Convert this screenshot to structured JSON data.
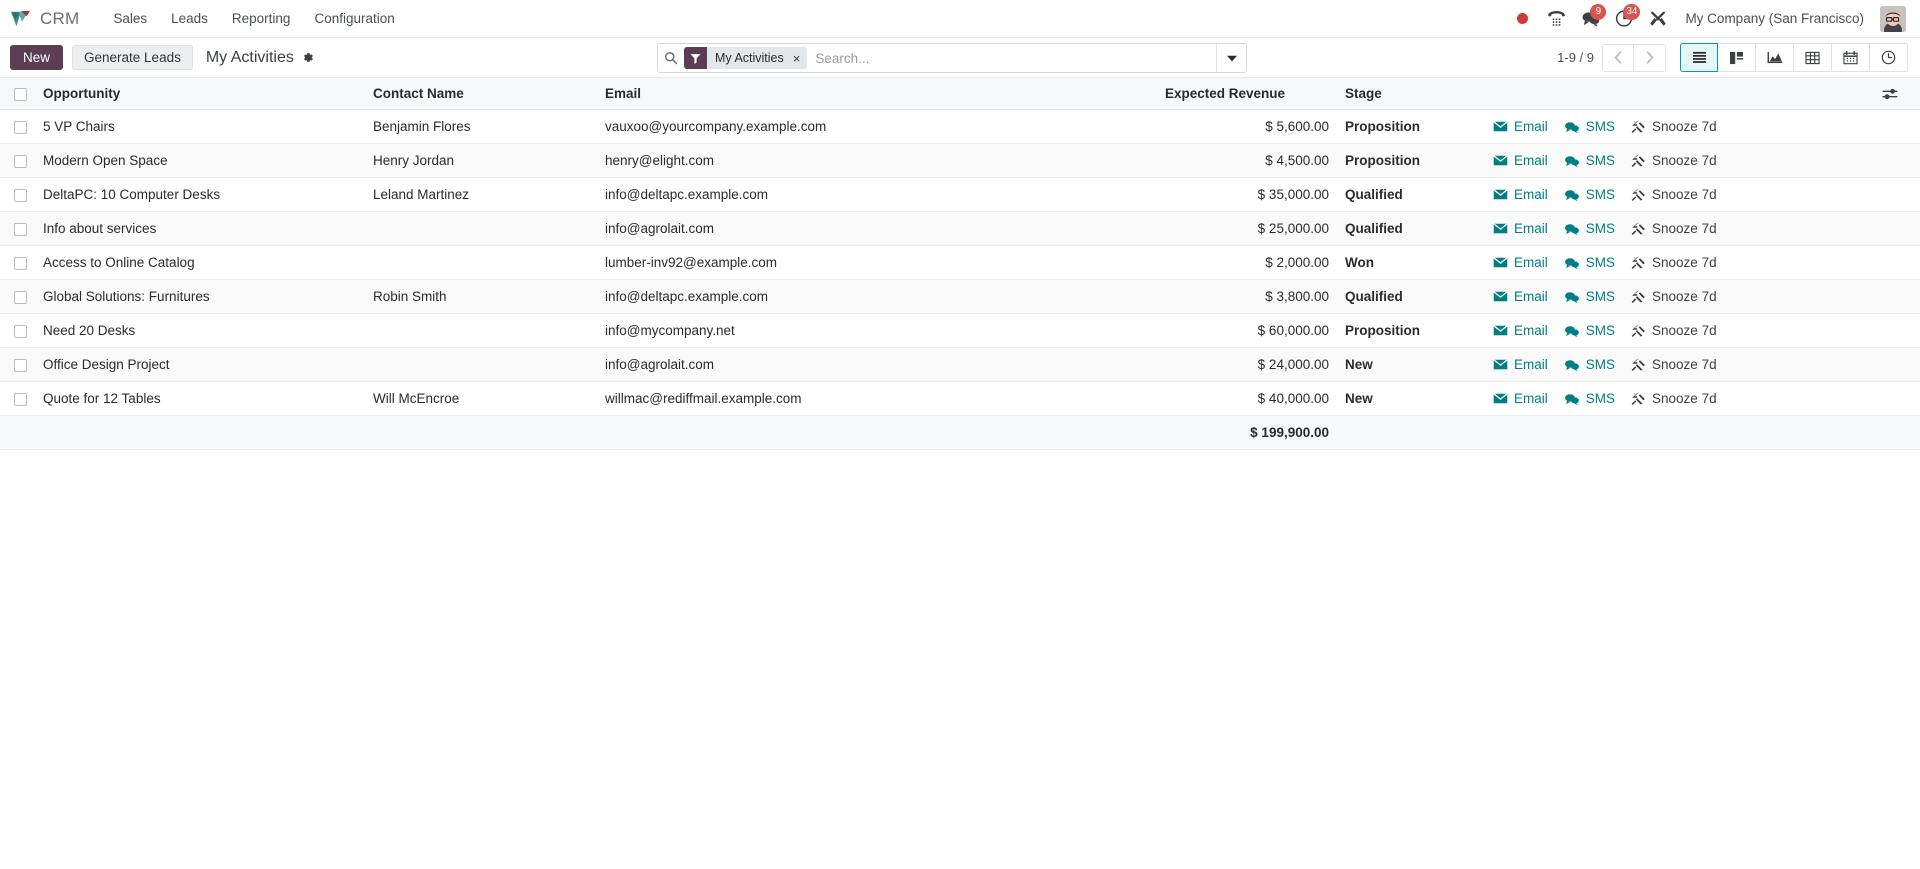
{
  "navbar": {
    "brand": "CRM",
    "brand_logo_icon": "odoo-crm-logo-icon",
    "menu": [
      {
        "label": "Sales"
      },
      {
        "label": "Leads"
      },
      {
        "label": "Reporting"
      },
      {
        "label": "Configuration"
      }
    ],
    "systray": [
      {
        "icon": "record-dot-icon",
        "badge": ""
      },
      {
        "icon": "voip-phone-icon",
        "badge": ""
      },
      {
        "icon": "messages-chat-icon",
        "badge": "9"
      },
      {
        "icon": "activities-clock-icon",
        "badge": "34"
      },
      {
        "icon": "debug-tools-icon",
        "badge": ""
      }
    ],
    "company": "My Company (San Francisco)",
    "avatar_icon": "user-avatar"
  },
  "control_panel": {
    "new_label": "New",
    "generate_leads_label": "Generate Leads",
    "breadcrumb_title": "My Activities",
    "settings_icon": "gear-icon",
    "search": {
      "search_icon": "search-icon",
      "facet_icon": "filter-funnel-icon",
      "facet_label": "My Activities",
      "facet_remove": "×",
      "placeholder": "Search...",
      "value": "",
      "dropdown_icon": "chevron-down-icon"
    },
    "pager": {
      "range": "1-9 / 9",
      "previous_icon": "chevron-left-icon",
      "next_icon": "chevron-right-icon"
    },
    "views": [
      {
        "name": "list",
        "icon": "list-view-icon",
        "active": true
      },
      {
        "name": "kanban",
        "icon": "kanban-view-icon",
        "active": false
      },
      {
        "name": "graph",
        "icon": "graph-view-icon",
        "active": false
      },
      {
        "name": "pivot",
        "icon": "pivot-view-icon",
        "active": false
      },
      {
        "name": "calendar",
        "icon": "calendar-view-icon",
        "active": false
      },
      {
        "name": "activity",
        "icon": "activity-view-icon",
        "active": false
      }
    ]
  },
  "table": {
    "columns": {
      "opportunity": "Opportunity",
      "contact_name": "Contact Name",
      "email": "Email",
      "expected_revenue": "Expected Revenue",
      "stage": "Stage"
    },
    "optional_columns_icon": "sliders-toggle-icon",
    "action_labels": {
      "email": "Email",
      "sms": "SMS",
      "snooze": "Snooze 7d"
    },
    "rows": [
      {
        "opportunity": "5 VP Chairs",
        "contact": "Benjamin Flores",
        "email": "vauxoo@yourcompany.example.com",
        "revenue": "$ 5,600.00",
        "stage": "Proposition"
      },
      {
        "opportunity": "Modern Open Space",
        "contact": "Henry Jordan",
        "email": "henry@elight.com",
        "revenue": "$ 4,500.00",
        "stage": "Proposition"
      },
      {
        "opportunity": "DeltaPC: 10 Computer Desks",
        "contact": "Leland Martinez",
        "email": "info@deltapc.example.com",
        "revenue": "$ 35,000.00",
        "stage": "Qualified"
      },
      {
        "opportunity": "Info about services",
        "contact": "",
        "email": "info@agrolait.com",
        "revenue": "$ 25,000.00",
        "stage": "Qualified"
      },
      {
        "opportunity": "Access to Online Catalog",
        "contact": "",
        "email": "lumber-inv92@example.com",
        "revenue": "$ 2,000.00",
        "stage": "Won"
      },
      {
        "opportunity": "Global Solutions: Furnitures",
        "contact": "Robin Smith",
        "email": "info@deltapc.example.com",
        "revenue": "$ 3,800.00",
        "stage": "Qualified"
      },
      {
        "opportunity": "Need 20 Desks",
        "contact": "",
        "email": "info@mycompany.net",
        "revenue": "$ 60,000.00",
        "stage": "Proposition"
      },
      {
        "opportunity": "Office Design Project",
        "contact": "",
        "email": "info@agrolait.com",
        "revenue": "$ 24,000.00",
        "stage": "New"
      },
      {
        "opportunity": "Quote for 12 Tables",
        "contact": "Will McEncroe",
        "email": "willmac@rediffmail.example.com",
        "revenue": "$ 40,000.00",
        "stage": "New"
      }
    ],
    "total_revenue": "$ 199,900.00"
  },
  "colors": {
    "accent_teal": "#00a09d",
    "link_teal": "#017e84",
    "primary_button": "#5c3d54",
    "badge_red": "#d9534f"
  }
}
